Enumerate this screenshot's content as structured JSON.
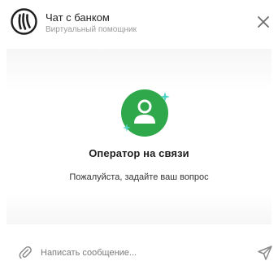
{
  "header": {
    "title": "Чат с банком",
    "subtitle": "Виртуальный помощник",
    "logo_icon": "bank-logo-icon",
    "close_icon": "close-icon"
  },
  "status": {
    "icon": "operator-avatar-icon",
    "title": "Оператор на связи",
    "subtitle": "Пожалуйста, задайте ваш вопрос"
  },
  "composer": {
    "placeholder": "Написать сообщение...",
    "value": "",
    "attach_icon": "paperclip-icon",
    "send_icon": "send-icon"
  },
  "colors": {
    "accent_green": "#2ea84a",
    "logo_dark": "#1f1f1f",
    "icon_gray": "#8a8a8a",
    "sparkle": "#4fd3c4"
  }
}
